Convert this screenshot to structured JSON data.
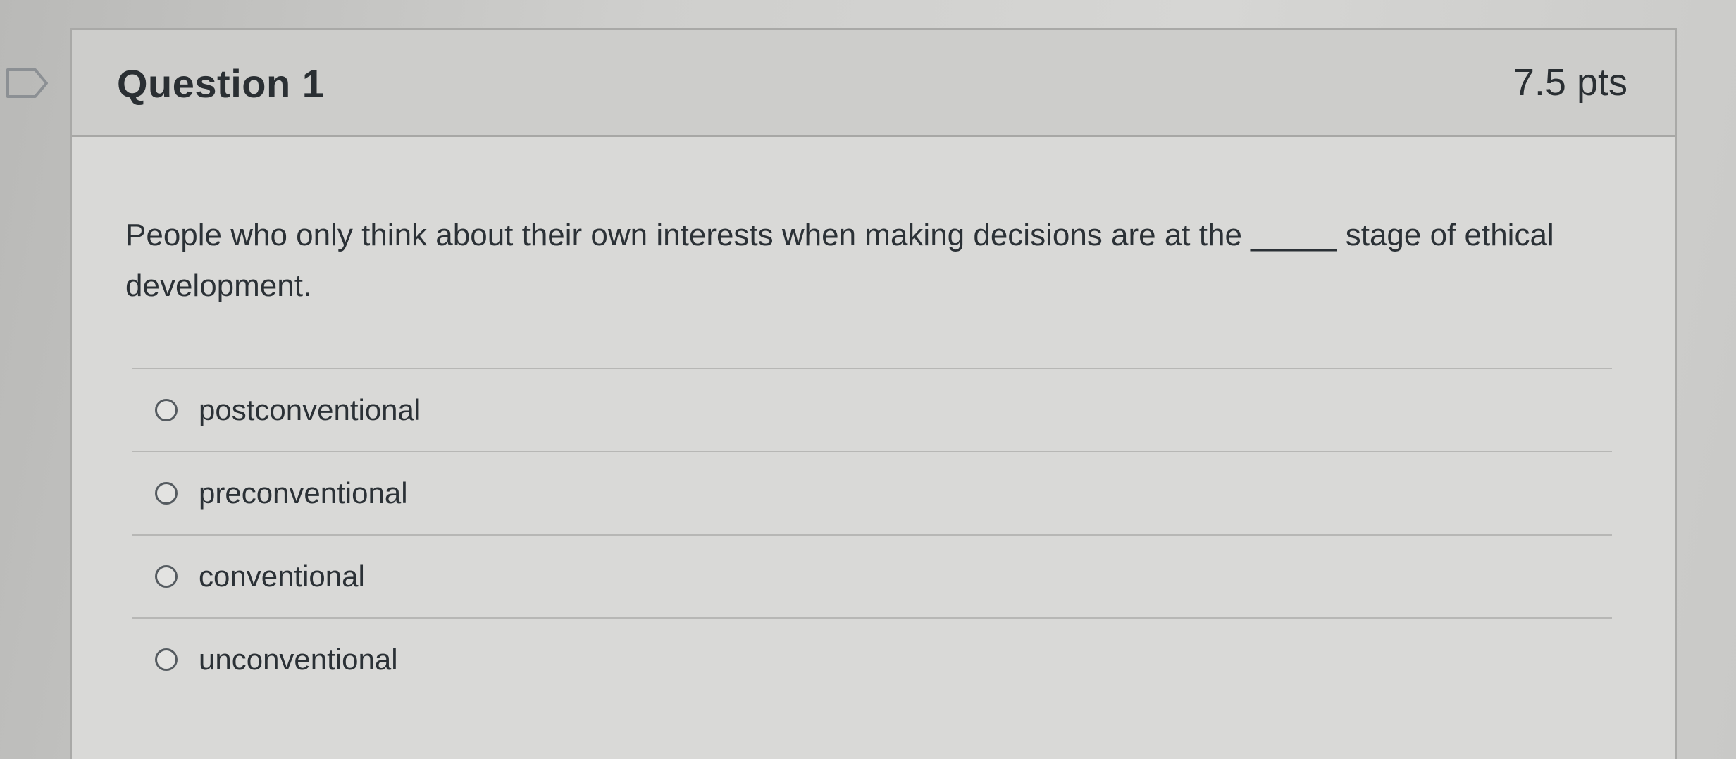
{
  "question": {
    "title": "Question 1",
    "points": "7.5 pts",
    "text": "People who only think about their own interests when making decisions are at the _____ stage of ethical development.",
    "answers": [
      {
        "label": "postconventional",
        "selected": false
      },
      {
        "label": "preconventional",
        "selected": false
      },
      {
        "label": "conventional",
        "selected": false
      },
      {
        "label": "unconventional",
        "selected": false
      }
    ]
  },
  "icons": {
    "flag": "flag-question-icon"
  },
  "colors": {
    "text": "#2d3b45",
    "header_bg": "#cdcdcb",
    "card_bg": "#d9d9d7"
  }
}
